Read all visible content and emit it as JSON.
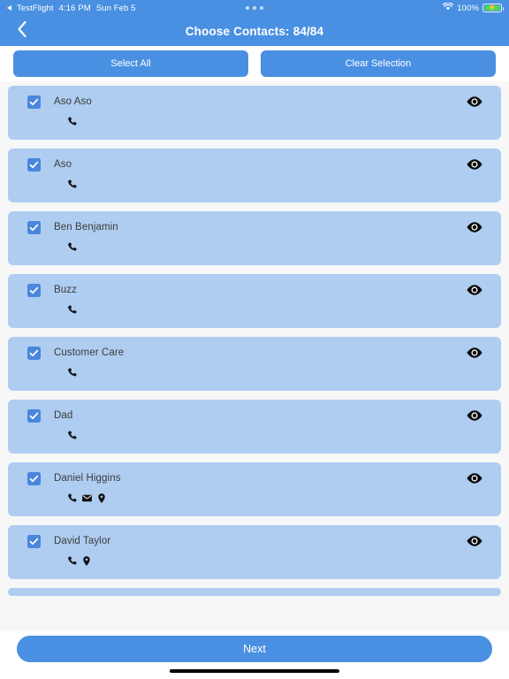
{
  "statusbar": {
    "back_app": "TestFlight",
    "time": "4:16 PM",
    "date": "Sun Feb 5",
    "battery_percent": "100%",
    "wifi_icon": "wifi-icon",
    "battery_icon": "battery-charging-icon",
    "dots_indicator": "three-dots-icon",
    "bar_color": "#4a90e2",
    "battery_fill_color": "#4cd55f"
  },
  "header": {
    "back_icon": "chevron-left-icon",
    "title": "Choose Contacts:",
    "count": "84/84",
    "background": "#4a90e2",
    "text_color": "#ffffff"
  },
  "actions": {
    "select_all_label": "Select All",
    "clear_selection_label": "Clear Selection",
    "button_color": "#4a90e2"
  },
  "list": {
    "row_background": "#aecdf0",
    "list_background": "#f7f7f7",
    "checkbox_color": "#4a86dd",
    "partial_top_row": {
      "icons": [
        "phone-icon"
      ]
    },
    "partial_bottom_row": {},
    "rows": [
      {
        "name": "Aso Aso",
        "checked": true,
        "icons": [
          "phone-icon"
        ],
        "eye": "eye-icon"
      },
      {
        "name": "Aso",
        "checked": true,
        "icons": [
          "phone-icon"
        ],
        "eye": "eye-icon"
      },
      {
        "name": "Ben Benjamin",
        "checked": true,
        "icons": [
          "phone-icon"
        ],
        "eye": "eye-icon"
      },
      {
        "name": "Buzz",
        "checked": true,
        "icons": [
          "phone-icon"
        ],
        "eye": "eye-icon"
      },
      {
        "name": "Customer Care",
        "checked": true,
        "icons": [
          "phone-icon"
        ],
        "eye": "eye-icon"
      },
      {
        "name": "Dad",
        "checked": true,
        "icons": [
          "phone-icon"
        ],
        "eye": "eye-icon"
      },
      {
        "name": "Daniel Higgins",
        "checked": true,
        "icons": [
          "phone-icon",
          "mail-icon",
          "location-icon"
        ],
        "eye": "eye-icon"
      },
      {
        "name": "David Taylor",
        "checked": true,
        "icons": [
          "phone-icon",
          "location-icon"
        ],
        "eye": "eye-icon"
      }
    ]
  },
  "footer": {
    "next_label": "Next",
    "button_color": "#4a90e2",
    "home_indicator": "home-indicator"
  }
}
